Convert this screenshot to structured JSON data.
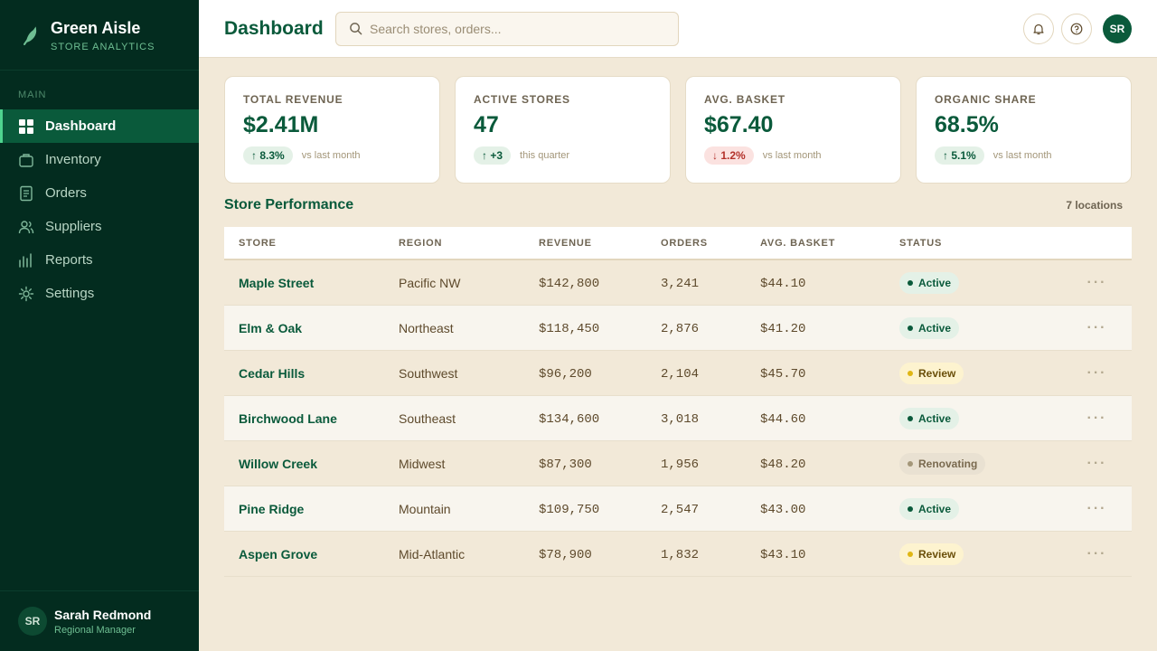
{
  "brand": {
    "name": "Green Aisle",
    "subtitle": "STORE ANALYTICS"
  },
  "nav": {
    "section": "MAIN",
    "items": [
      {
        "label": "Dashboard",
        "icon": "grid-icon",
        "active": true
      },
      {
        "label": "Inventory",
        "icon": "box-icon"
      },
      {
        "label": "Orders",
        "icon": "document-icon"
      },
      {
        "label": "Suppliers",
        "icon": "users-icon"
      },
      {
        "label": "Reports",
        "icon": "bar-chart-icon"
      },
      {
        "label": "Settings",
        "icon": "gear-icon"
      }
    ]
  },
  "user": {
    "initials": "SR",
    "name": "Sarah Redmond",
    "role": "Regional Manager"
  },
  "header": {
    "title": "Dashboard",
    "search_placeholder": "Search stores, orders...",
    "avatar": "SR"
  },
  "kpis": [
    {
      "label": "TOTAL REVENUE",
      "value": "$2.41M",
      "delta": "8.3%",
      "direction": "up",
      "note": "vs last month"
    },
    {
      "label": "ACTIVE STORES",
      "value": "47",
      "delta": "+3",
      "direction": "up",
      "note": "this quarter"
    },
    {
      "label": "AVG. BASKET",
      "value": "$67.40",
      "delta": "1.2%",
      "direction": "down",
      "note": "vs last month"
    },
    {
      "label": "ORGANIC SHARE",
      "value": "68.5%",
      "delta": "5.1%",
      "direction": "up",
      "note": "vs last month"
    }
  ],
  "table": {
    "title": "Store Performance",
    "count": "7 locations",
    "columns": [
      "STORE",
      "REGION",
      "REVENUE",
      "ORDERS",
      "AVG. BASKET",
      "STATUS"
    ],
    "rows": [
      {
        "store": "Maple Street",
        "region": "Pacific NW",
        "revenue": "$142,800",
        "orders": "3,241",
        "basket": "$44.10",
        "status": "Active"
      },
      {
        "store": "Elm & Oak",
        "region": "Northeast",
        "revenue": "$118,450",
        "orders": "2,876",
        "basket": "$41.20",
        "status": "Active"
      },
      {
        "store": "Cedar Hills",
        "region": "Southwest",
        "revenue": "$96,200",
        "orders": "2,104",
        "basket": "$45.70",
        "status": "Review"
      },
      {
        "store": "Birchwood Lane",
        "region": "Southeast",
        "revenue": "$134,600",
        "orders": "3,018",
        "basket": "$44.60",
        "status": "Active"
      },
      {
        "store": "Willow Creek",
        "region": "Midwest",
        "revenue": "$87,300",
        "orders": "1,956",
        "basket": "$48.20",
        "status": "Renovating"
      },
      {
        "store": "Pine Ridge",
        "region": "Mountain",
        "revenue": "$109,750",
        "orders": "2,547",
        "basket": "$43.00",
        "status": "Active"
      },
      {
        "store": "Aspen Grove",
        "region": "Mid-Atlantic",
        "revenue": "$78,900",
        "orders": "1,832",
        "basket": "$43.10",
        "status": "Review"
      }
    ],
    "row_menu": "···"
  },
  "colors": {
    "sidebar": "#032c1f",
    "accent": "#0a5a3b",
    "background": "#f2e9d8"
  }
}
